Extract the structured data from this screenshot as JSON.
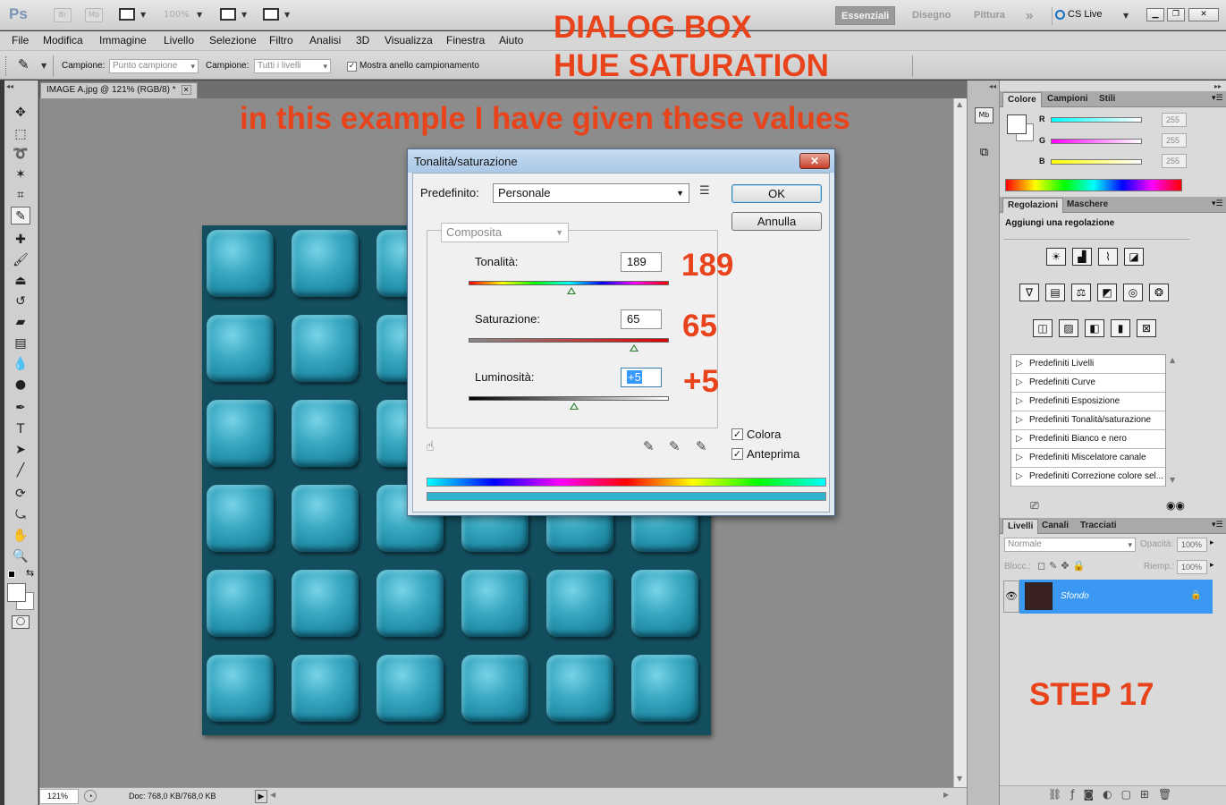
{
  "app": {
    "logo": "Ps",
    "bridge": "Br",
    "minibridge": "Mb",
    "zoom": "100%",
    "workspaces": [
      "Essenziali",
      "Disegno",
      "Pittura"
    ],
    "more": "»",
    "cs_live": "CS Live"
  },
  "menu": [
    "File",
    "Modifica",
    "Immagine",
    "Livello",
    "Selezione",
    "Filtro",
    "Analisi",
    "3D",
    "Visualizza",
    "Finestra",
    "Aiuto"
  ],
  "options": {
    "sample_label": "Campione:",
    "sample_value": "Punto campione",
    "sample2_label": "Campione:",
    "sample2_value": "Tutti i livelli",
    "ring_label": "Mostra anello campionamento"
  },
  "document": {
    "tab_title": "IMAGE A.jpg @ 121% (RGB/8) *",
    "status_zoom": "121%",
    "status_doc": "Doc: 768,0 KB/768,0 KB"
  },
  "annotations": {
    "line1": "DIALOG BOX",
    "line2": "HUE SATURATION",
    "line3": "in this example I have given these values",
    "v_hue": "189",
    "v_sat": "65",
    "v_lum": "+5",
    "step": "STEP 17"
  },
  "dialog": {
    "title": "Tonalità/saturazione",
    "close": "✕",
    "preset_label": "Predefinito:",
    "preset_value": "Personale",
    "ok": "OK",
    "cancel": "Annulla",
    "channel": "Composita",
    "hue_label": "Tonalità:",
    "hue_value": "189",
    "sat_label": "Saturazione:",
    "sat_value": "65",
    "lum_label": "Luminosità:",
    "lum_value": "+5",
    "colorize": "Colora",
    "preview": "Anteprima"
  },
  "sliders": {
    "hue": {
      "min": -180,
      "max": 180,
      "value": 189
    },
    "saturation": {
      "min": -100,
      "max": 100,
      "value": 65
    },
    "lightness": {
      "min": -100,
      "max": 100,
      "value": 5
    }
  },
  "color_panel": {
    "tabs": [
      "Colore",
      "Campioni",
      "Stili"
    ],
    "r_label": "R",
    "r_value": "255",
    "g_label": "G",
    "g_value": "255",
    "b_label": "B",
    "b_value": "255"
  },
  "adjust_panel": {
    "tabs": [
      "Regolazioni",
      "Maschere"
    ],
    "heading": "Aggiungi una regolazione",
    "presets": [
      "Predefiniti Livelli",
      "Predefiniti Curve",
      "Predefiniti Esposizione",
      "Predefiniti Tonalità/saturazione",
      "Predefiniti Bianco e nero",
      "Predefiniti Miscelatore canale",
      "Predefiniti Correzione colore sel..."
    ]
  },
  "layers_panel": {
    "tabs": [
      "Livelli",
      "Canali",
      "Tracciati"
    ],
    "blend": "Normale",
    "opacity_label": "Opacità:",
    "opacity": "100%",
    "lock_label": "Blocc.:",
    "fill_label": "Riemp.:",
    "fill": "100%",
    "layer_name": "Sfondo"
  },
  "colors": {
    "annotation": "#e8431b",
    "tile": "#2e9fb9",
    "selection": "#3a97f2"
  }
}
